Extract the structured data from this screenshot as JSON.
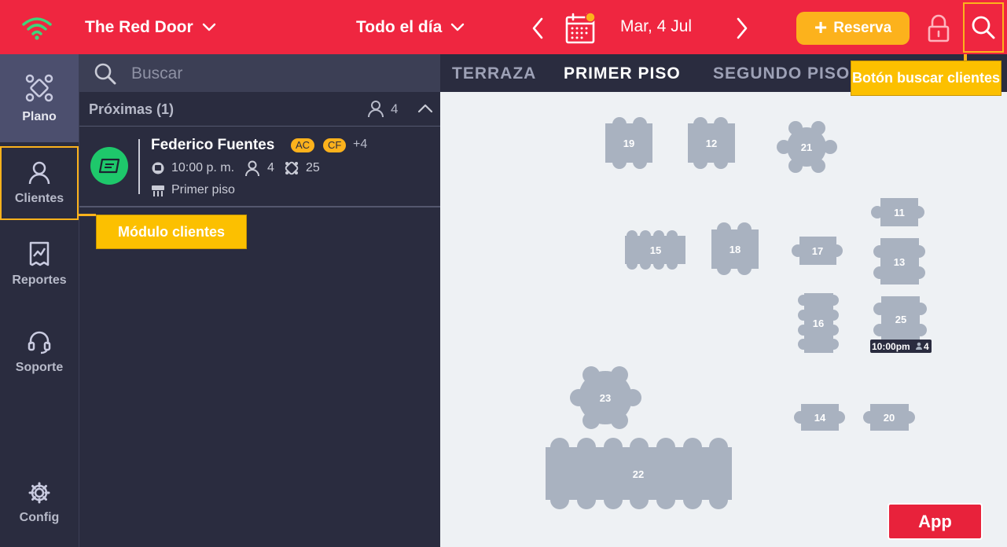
{
  "topbar": {
    "venue": "The Red Door",
    "shift": "Todo el día",
    "date": "Mar, 4 Jul",
    "reserva_label": "Reserva",
    "wifi_icon": "wifi-icon",
    "calendar_icon": "calendar-icon",
    "lock_icon": "lock-icon",
    "search_icon": "search-icon"
  },
  "leftnav": {
    "items": [
      {
        "label": "Plano",
        "icon": "floor-plan-icon",
        "active": true
      },
      {
        "label": "Clientes",
        "icon": "person-icon",
        "active": false
      },
      {
        "label": "Reportes",
        "icon": "report-icon",
        "active": false
      },
      {
        "label": "Soporte",
        "icon": "headset-icon",
        "active": false
      },
      {
        "label": "Config",
        "icon": "gear-icon",
        "active": false
      }
    ]
  },
  "panel": {
    "search_placeholder": "Buscar",
    "section_title": "Próximas (1)",
    "section_guests": "4",
    "reservation": {
      "name": "Federico Fuentes",
      "tags": [
        "AC",
        "CF"
      ],
      "more_tags": "+4",
      "time": "10:00 p. m.",
      "guests": "4",
      "table": "25",
      "area": "Primer piso",
      "status_color": "#1ec86b"
    }
  },
  "floor": {
    "tabs": [
      "TERRAZA",
      "PRIMER PISO",
      "SEGUNDO PISO"
    ],
    "active_tab": "PRIMER PISO",
    "tables": [
      "19",
      "12",
      "21",
      "11",
      "15",
      "18",
      "17",
      "13",
      "16",
      "25",
      "23",
      "14",
      "20",
      "22"
    ],
    "table25_badge_time": "10:00pm",
    "table25_badge_guests": "4"
  },
  "callouts": {
    "search": "Botón buscar clientes",
    "clients": "Módulo clientes",
    "app": "App"
  },
  "colors": {
    "brand_red": "#ef2640",
    "accent_yellow": "#fcb21c",
    "sidebar_dark": "#2a2c3f",
    "table_gray": "#a9b2c0"
  }
}
